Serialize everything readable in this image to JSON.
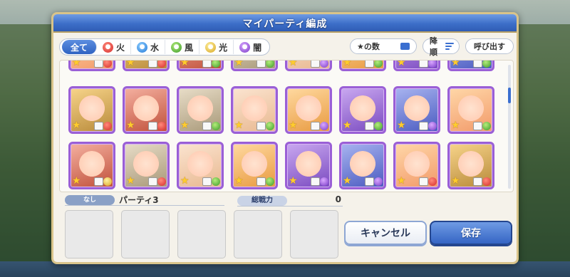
{
  "modal": {
    "title": "マイパーティ編成"
  },
  "filters": [
    {
      "label": "全て",
      "icon": "all",
      "active": true
    },
    {
      "label": "火",
      "icon": "fire-icon",
      "color": "#d62d2d"
    },
    {
      "label": "水",
      "icon": "water-icon",
      "color": "#2478d8"
    },
    {
      "label": "風",
      "icon": "wind-icon",
      "color": "#3a9a2a"
    },
    {
      "label": "光",
      "icon": "light-icon",
      "color": "#d8a520"
    },
    {
      "label": "闇",
      "icon": "dark-icon",
      "color": "#7a3bc8"
    }
  ],
  "toolbar": {
    "stars_label": "★の数",
    "sort_label": "降順",
    "call_label": "呼び出す"
  },
  "roster": {
    "rows": [
      {
        "cards": [
          {
            "element": "fire",
            "rarity_icon": "star-icon"
          },
          {
            "element": "fire",
            "rarity_icon": "star-icon"
          },
          {
            "element": "wind",
            "rarity_icon": "star-icon"
          },
          {
            "element": "wind",
            "rarity_icon": "star-icon"
          },
          {
            "element": "dark",
            "rarity_icon": "star-icon"
          },
          {
            "element": "wind",
            "rarity_icon": "star-icon"
          },
          {
            "element": "dark",
            "rarity_icon": "star-icon"
          },
          {
            "element": "wind",
            "rarity_icon": "star-icon"
          }
        ]
      },
      {
        "cards": [
          {
            "element": "light",
            "rarity_icon": "star-icon"
          },
          {
            "element": "fire",
            "rarity_icon": "star-icon"
          },
          {
            "element": "wind",
            "rarity_icon": "star-icon"
          },
          {
            "element": "wind",
            "rarity_icon": "star-icon"
          },
          {
            "element": "dark",
            "rarity_icon": "star-icon"
          },
          {
            "element": "dark",
            "rarity_icon": "star-icon"
          },
          {
            "element": "fire",
            "rarity_icon": "star-icon"
          },
          {
            "element": "fire",
            "rarity_icon": "star-icon"
          }
        ]
      }
    ]
  },
  "party": {
    "status_pill": "なし",
    "name": "パーティ3",
    "power_label": "総戦力",
    "power_value": "0"
  },
  "buttons": {
    "cancel": "キャンセル",
    "save": "保存"
  }
}
